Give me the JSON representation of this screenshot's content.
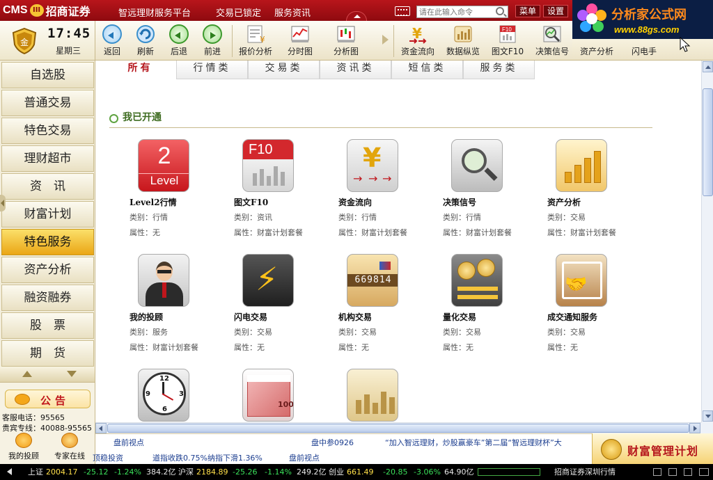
{
  "topbar": {
    "logo_text": "CMS",
    "logo_badge": "III",
    "logo_name": "招商证券",
    "platform": "智远理财服务平台",
    "trade_lock": "交易已锁定",
    "info": "服务资讯",
    "command_placeholder": "请在此输入命令",
    "menu_label": "菜单",
    "settings_label": "设置"
  },
  "brand": {
    "title": "分析家公式网",
    "url": "www.88gs.com"
  },
  "clock": {
    "time": "17:45",
    "weekday": "星期三"
  },
  "toolbar": {
    "items": [
      {
        "label": "返回",
        "icon": "back-icon"
      },
      {
        "label": "刷新",
        "icon": "refresh-icon"
      },
      {
        "label": "后退",
        "icon": "backward-icon"
      },
      {
        "label": "前进",
        "icon": "forward-icon"
      },
      {
        "label": "报价分析",
        "icon": "quote-analysis-icon"
      },
      {
        "label": "分时图",
        "icon": "timeshare-chart-icon"
      },
      {
        "label": "分析图",
        "icon": "candlestick-chart-icon"
      },
      {
        "label": "资金流向",
        "icon": "fund-flow-icon"
      },
      {
        "label": "数据纵览",
        "icon": "data-overview-icon"
      },
      {
        "label": "图文F10",
        "icon": "f10-icon"
      },
      {
        "label": "决策信号",
        "icon": "decision-signal-icon"
      },
      {
        "label": "资产分析",
        "icon": "asset-analysis-icon"
      },
      {
        "label": "闪电手",
        "icon": "lightning-icon"
      }
    ]
  },
  "sidebar": {
    "items": [
      {
        "label": "自选股"
      },
      {
        "label": "普通交易"
      },
      {
        "label": "特色交易"
      },
      {
        "label": "理财超市"
      },
      {
        "label": "资　讯"
      },
      {
        "label": "财富计划"
      },
      {
        "label": "特色服务"
      },
      {
        "label": "资产分析"
      },
      {
        "label": "融资融券"
      },
      {
        "label": "股　票"
      },
      {
        "label": "期　货"
      }
    ],
    "active": "特色服务",
    "notice_label": "公告",
    "hotline1": "客服电话：95565",
    "hotline2": "贵宾专线：40088-95565",
    "my_advisor": "我的投顾",
    "expert_online": "专家在线"
  },
  "tabs": [
    {
      "label": "所有"
    },
    {
      "label": "行情类"
    },
    {
      "label": "交易类"
    },
    {
      "label": "资讯类"
    },
    {
      "label": "短信类"
    },
    {
      "label": "服务类"
    }
  ],
  "section": {
    "title": "我已开通"
  },
  "services": [
    {
      "name": "Level2行情",
      "category": "类别：行情",
      "attribute": "属性：无",
      "icon": "level2-icon",
      "icon_number": "2",
      "icon_word": "Level"
    },
    {
      "name": "图文F10",
      "category": "类别：资讯",
      "attribute": "属性：财富计划套餐",
      "icon": "f10-icon",
      "icon_text": "F10"
    },
    {
      "name": "资金流向",
      "category": "类别：行情",
      "attribute": "属性：财富计划套餐",
      "icon": "yuan-flow-icon",
      "icon_text": "¥"
    },
    {
      "name": "决策信号",
      "category": "类别：行情",
      "attribute": "属性：财富计划套餐",
      "icon": "magnifier-chart-icon"
    },
    {
      "name": "资产分析",
      "category": "类别：交易",
      "attribute": "属性：财富计划套餐",
      "icon": "bar-growth-icon"
    },
    {
      "name": "我的投顾",
      "category": "类别：服务",
      "attribute": "属性：财富计划套餐",
      "icon": "advisor-icon"
    },
    {
      "name": "闪电交易",
      "category": "类别：交易",
      "attribute": "属性：无",
      "icon": "lightning-icon",
      "icon_text": "⚡"
    },
    {
      "name": "机构交易",
      "category": "类别：交易",
      "attribute": "属性：无",
      "icon": "institution-card-icon",
      "icon_text": "669814"
    },
    {
      "name": "量化交易",
      "category": "类别：交易",
      "attribute": "属性：无",
      "icon": "coin-exchange-icon"
    },
    {
      "name": "成交通知服务",
      "category": "类别：交易",
      "attribute": "属性：无",
      "icon": "handshake-icon",
      "icon_text": "🤝"
    },
    {
      "name": "",
      "category": "",
      "attribute": "",
      "icon": "clock-icon",
      "icon_nums": [
        "12",
        "9",
        "3",
        "6"
      ]
    },
    {
      "name": "",
      "category": "",
      "attribute": "",
      "icon": "banknote-icon",
      "icon_text": "100"
    },
    {
      "name": "",
      "category": "",
      "attribute": "",
      "icon": "report-chart-icon"
    }
  ],
  "ticker": {
    "row1": [
      "盘前视点",
      "盘中参0926",
      "“加入智远理财，炒股赢豪车”第二届“智远理财杯”大"
    ],
    "row2": [
      "顶稳投资",
      "道指收跌0.75%纳指下滑1.36%",
      "盘前视点"
    ]
  },
  "wealth_banner": "财富管理计划",
  "statusbar": {
    "sh_label": "上证",
    "sh_index": "2004.17",
    "sh_change": "-25.12",
    "sh_pct": "-1.24%",
    "sh_amount": "384.2亿",
    "sz_label": "沪深",
    "sz_index": "2184.89",
    "sz_change": "-25.26",
    "sz_pct": "-1.14%",
    "sz_amount": "249.2亿",
    "cy_label": "创业",
    "cy_index": "661.49",
    "cy_change": "-20.85",
    "cy_pct": "-3.06%",
    "cy_amount": "64.90亿",
    "broker": "招商证券深圳行情"
  },
  "colors": {
    "brand_red": "#b8151b",
    "accent_gold": "#eaa615",
    "up": "#ff3030",
    "down": "#3be05a"
  }
}
